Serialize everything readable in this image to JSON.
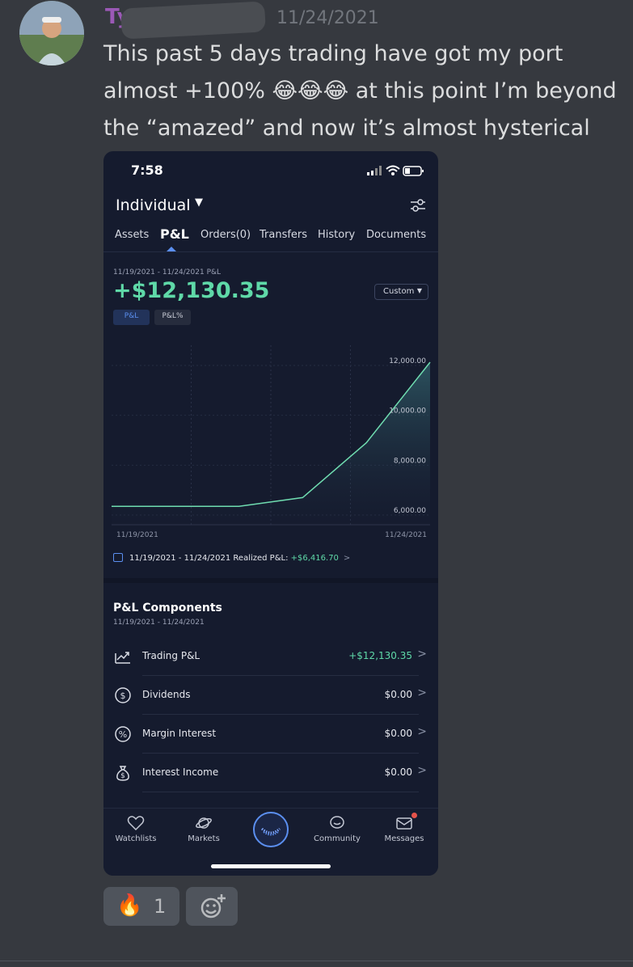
{
  "message": {
    "username": "Ty            ck",
    "timestamp": "11/24/2021",
    "text": "This past 5 days trading have got my port almost +100% 😂😂😂 at this point I’m beyond the “amazed” and now it’s almost hysterical"
  },
  "phone": {
    "status_time": "7:58",
    "account_name": "Individual",
    "tabs": [
      "Assets",
      "P&L",
      "Orders(0)",
      "Transfers",
      "History",
      "Documents"
    ],
    "active_tab": "P&L",
    "range_label": "11/19/2021 - 11/24/2021 P&L",
    "pnl_value": "+$12,130.35",
    "period_select": "Custom",
    "toggles": [
      "P&L",
      "P&L%"
    ],
    "realized_label": "11/19/2021 - 11/24/2021 Realized P&L:",
    "realized_value": "+$6,416.70",
    "components_title": "P&L Components",
    "components_range": "11/19/2021 - 11/24/2021",
    "components": [
      {
        "label": "Trading P&L",
        "value": "+$12,130.35",
        "icon": "trend-chart-icon"
      },
      {
        "label": "Dividends",
        "value": "$0.00",
        "icon": "dividend-icon"
      },
      {
        "label": "Margin Interest",
        "value": "$0.00",
        "icon": "percent-icon"
      },
      {
        "label": "Interest Income",
        "value": "$0.00",
        "icon": "money-bag-icon"
      }
    ],
    "nav": [
      "Watchlists",
      "Markets",
      "Community",
      "Messages"
    ]
  },
  "reactions": {
    "fire_emoji": "🔥",
    "fire_count": "1"
  },
  "colors": {
    "positive": "#5fd9a8",
    "accent": "#5b8ff0",
    "username": "#9b59b6"
  },
  "chart_data": {
    "type": "area",
    "x": [
      "11/19/2021",
      "11/20/2021",
      "11/21/2021",
      "11/22/2021",
      "11/23/2021",
      "11/24/2021"
    ],
    "y": [
      6350,
      6350,
      6350,
      6700,
      8900,
      12130.35
    ],
    "x_tick_labels": [
      "11/19/2021",
      "11/24/2021"
    ],
    "y_ticks": [
      6000,
      8000,
      10000,
      12000
    ],
    "y_tick_labels": [
      "6,000.00",
      "8,000.00",
      "10,000.00",
      "12,000.00"
    ],
    "ylim": [
      6000,
      12000
    ],
    "grid": true
  }
}
